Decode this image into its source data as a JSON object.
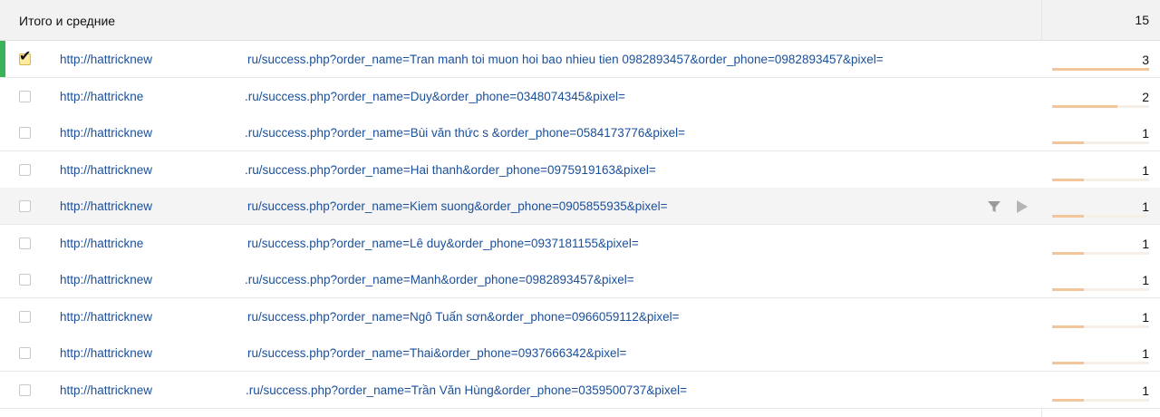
{
  "header": {
    "title": "Итого и средние",
    "total": "15"
  },
  "icons": {
    "filter": "filter-icon",
    "play": "play-icon",
    "check": "checkmark-icon"
  },
  "colors": {
    "link": "#1a4f9c",
    "marker": "#3cb25b",
    "bar": "#f3c59a"
  },
  "rows": [
    {
      "url_start": "http://hattricknew",
      "url_end": "ru/success.php?order_name=Tran manh toi muon hoi bao nhieu tien 0982893457&order_phone=0982893457&pixel=",
      "count": "3",
      "share": 1.0,
      "checked": true,
      "hover": false
    },
    {
      "url_start": "http://hattrickne",
      "url_end": ".ru/success.php?order_name=Duy&order_phone=0348074345&pixel=",
      "count": "2",
      "share": 0.67,
      "checked": false,
      "hover": false
    },
    {
      "url_start": "http://hattricknew",
      "url_end": ".ru/success.php?order_name=Bùi văn thức s &order_phone=0584173776&pixel=",
      "count": "1",
      "share": 0.33,
      "checked": false,
      "hover": false
    },
    {
      "url_start": "http://hattricknew",
      "url_end": ".ru/success.php?order_name=Hai thanh&order_phone=0975919163&pixel=",
      "count": "1",
      "share": 0.33,
      "checked": false,
      "hover": false
    },
    {
      "url_start": "http://hattricknew",
      "url_end": "ru/success.php?order_name=Kiem suong&order_phone=0905855935&pixel=",
      "count": "1",
      "share": 0.33,
      "checked": false,
      "hover": true
    },
    {
      "url_start": "http://hattrickne",
      "url_end": "ru/success.php?order_name=Lê duy&order_phone=0937181155&pixel=",
      "count": "1",
      "share": 0.33,
      "checked": false,
      "hover": false
    },
    {
      "url_start": "http://hattricknew",
      "url_end": ".ru/success.php?order_name=Manh&order_phone=0982893457&pixel=",
      "count": "1",
      "share": 0.33,
      "checked": false,
      "hover": false
    },
    {
      "url_start": "http://hattricknew",
      "url_end": "ru/success.php?order_name=Ngô Tuấn sơn&order_phone=0966059112&pixel=",
      "count": "1",
      "share": 0.33,
      "checked": false,
      "hover": false
    },
    {
      "url_start": "http://hattricknew",
      "url_end": "ru/success.php?order_name=Thai&order_phone=0937666342&pixel=",
      "count": "1",
      "share": 0.33,
      "checked": false,
      "hover": false
    },
    {
      "url_start": "http://hattricknew",
      "url_end": ".ru/success.php?order_name=Trần Văn Hùng&order_phone=0359500737&pixel=",
      "count": "1",
      "share": 0.33,
      "checked": false,
      "hover": false
    }
  ]
}
